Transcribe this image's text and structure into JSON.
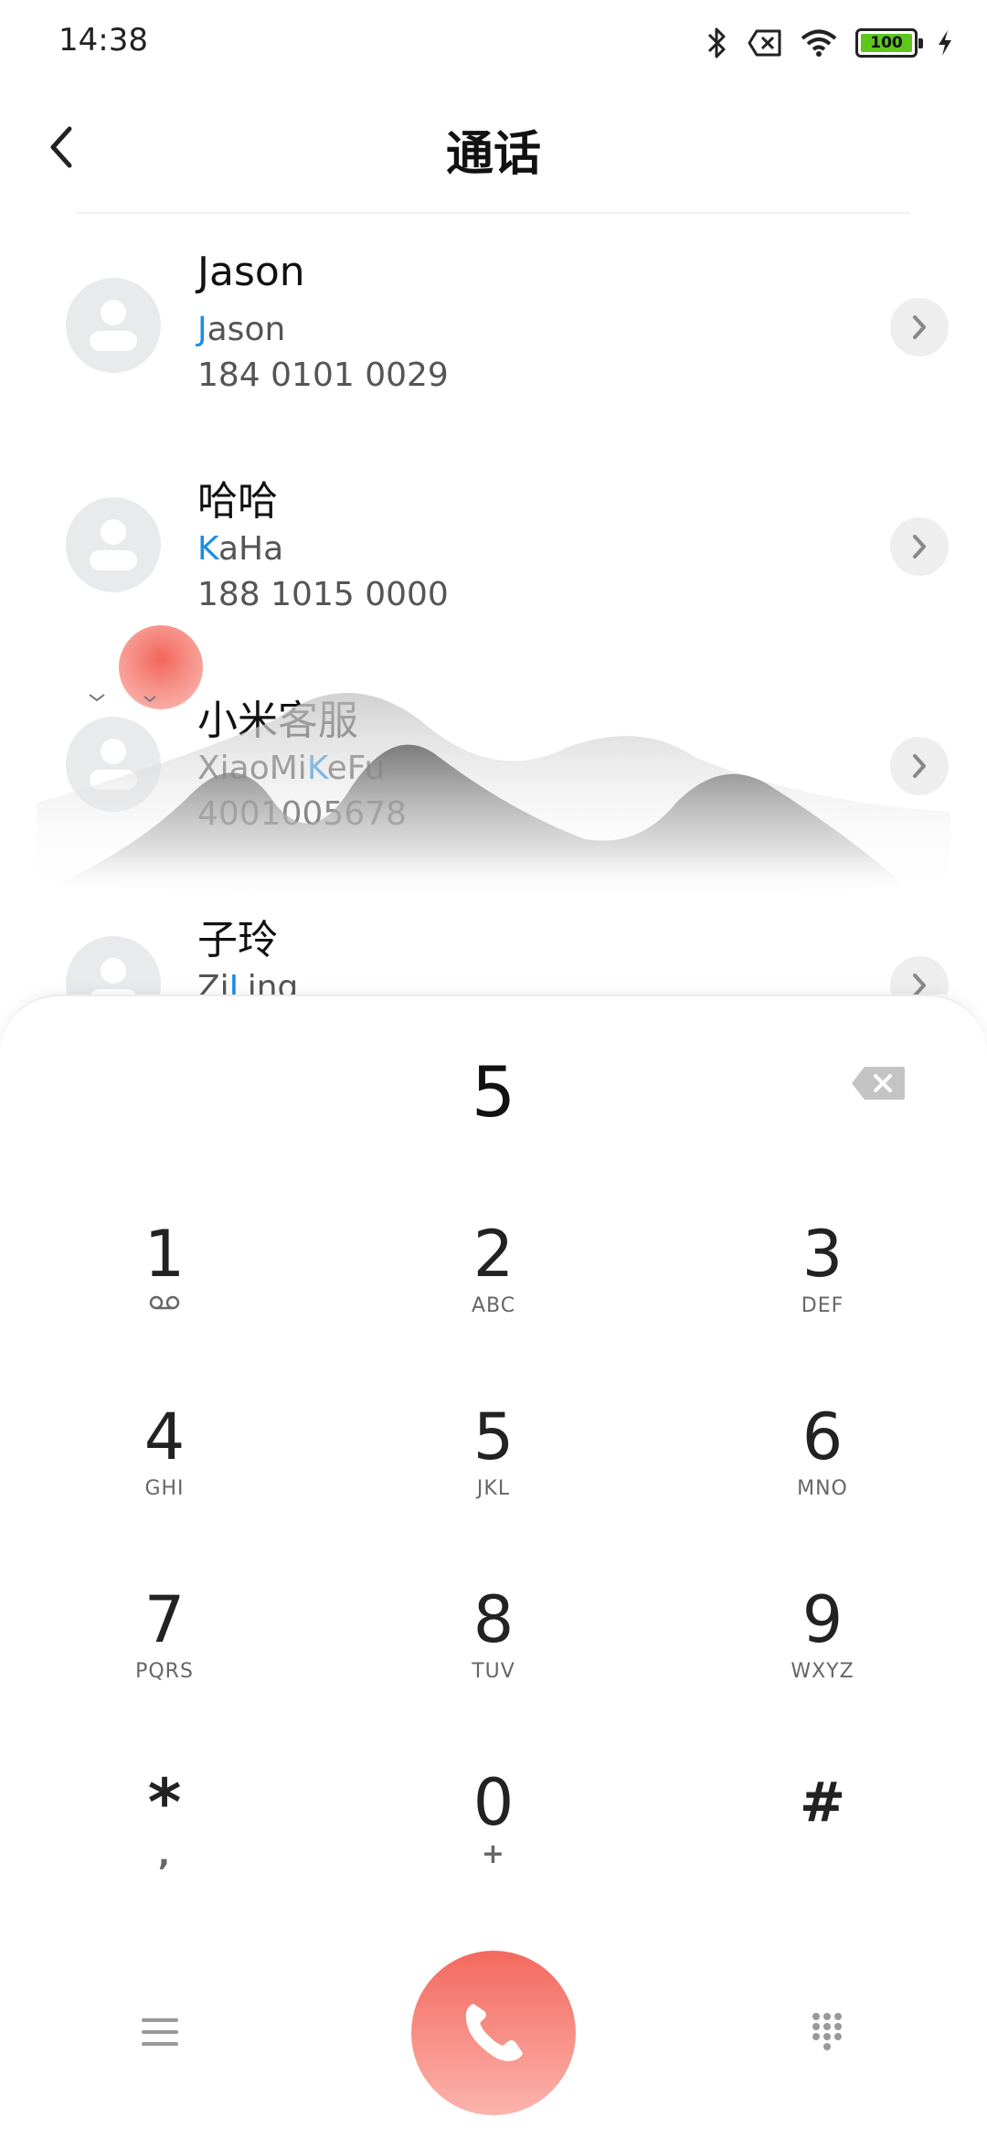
{
  "status_bar": {
    "time": "14:38",
    "battery_level": "100",
    "icons": [
      "bluetooth-icon",
      "sim-error-icon",
      "wifi-icon",
      "battery-icon",
      "charging-icon"
    ]
  },
  "header": {
    "title": "通话"
  },
  "contacts": [
    {
      "name": "Jason",
      "pinyin_match": "J",
      "pinyin_rest": "ason",
      "pinyin_pre": "",
      "number": "184 0101 0029"
    },
    {
      "name": "哈哈",
      "pinyin_pre": "",
      "pinyin_match": "K",
      "pinyin_rest": "aHa",
      "number": "188 1015 0000"
    },
    {
      "name": "小米客服",
      "pinyin_pre": "XiaoMi",
      "pinyin_match": "K",
      "pinyin_rest": "eFu",
      "number": "4001005678"
    },
    {
      "name": "子玲",
      "pinyin_pre": "Zi",
      "pinyin_match": "L",
      "pinyin_rest": "ing",
      "number": ""
    }
  ],
  "dialer": {
    "input_value": "5",
    "keys": [
      {
        "digit": "1",
        "letters": ""
      },
      {
        "digit": "2",
        "letters": "ABC"
      },
      {
        "digit": "3",
        "letters": "DEF"
      },
      {
        "digit": "4",
        "letters": "GHI"
      },
      {
        "digit": "5",
        "letters": "JKL"
      },
      {
        "digit": "6",
        "letters": "MNO"
      },
      {
        "digit": "7",
        "letters": "PQRS"
      },
      {
        "digit": "8",
        "letters": "TUV"
      },
      {
        "digit": "9",
        "letters": "WXYZ"
      },
      {
        "digit": "*",
        "letters": ","
      },
      {
        "digit": "0",
        "letters": "+"
      },
      {
        "digit": "#",
        "letters": ""
      }
    ]
  },
  "colors": {
    "accent_blue": "#1a8fe3",
    "call_red": "#f3695d",
    "battery_green": "#5ec61d"
  }
}
